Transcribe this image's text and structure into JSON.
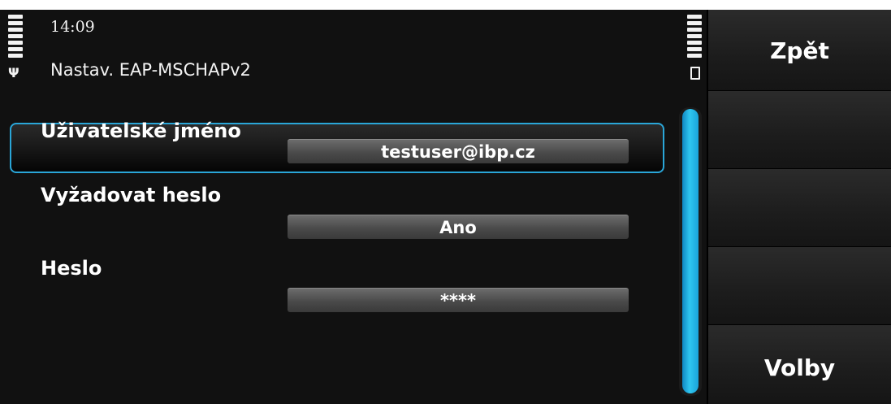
{
  "status": {
    "time": "14:09",
    "title": "Nastav. EAP-MSCHAPv2"
  },
  "settings": [
    {
      "label": "Uživatelské jméno",
      "value": "testuser@ibp.cz",
      "focused": true
    },
    {
      "label": "Vyžadovat heslo",
      "value": "Ano",
      "focused": false
    },
    {
      "label": "Heslo",
      "value": "****",
      "focused": false
    }
  ],
  "softkeys": {
    "back": "Zpět",
    "options": "Volby"
  },
  "colors": {
    "focus_border": "#2aa6d8",
    "scrollbar": "#2fc6f0",
    "background": "#111111"
  },
  "icons": {
    "signal": "signal-strength-icon",
    "antenna": "antenna-icon",
    "battery": "battery-icon"
  }
}
